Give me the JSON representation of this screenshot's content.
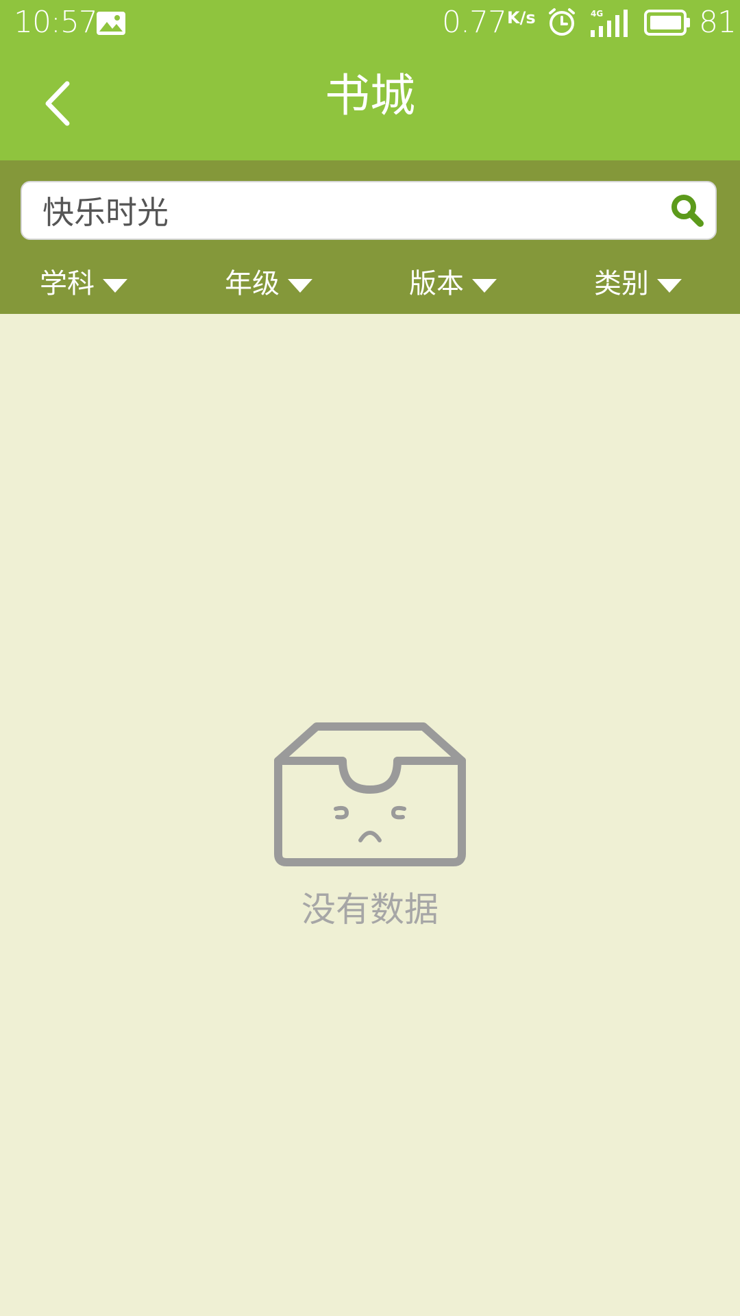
{
  "status_bar": {
    "time": "10:57",
    "network_speed": "0.77",
    "network_speed_unit": "K/s",
    "battery_level": "81"
  },
  "title_bar": {
    "title": "书城"
  },
  "search": {
    "value": "快乐时光"
  },
  "filters": [
    {
      "label": "学科"
    },
    {
      "label": "年级"
    },
    {
      "label": "版本"
    },
    {
      "label": "类别"
    }
  ],
  "empty_state": {
    "message": "没有数据"
  },
  "colors": {
    "header": "#8fc43e",
    "filter_bar": "#84983a",
    "background": "#eff0d4",
    "search_icon": "#5c9a1b",
    "empty_gray": "#a6a6a6"
  },
  "icons": {
    "back": "chevron-left-icon",
    "search": "search-icon",
    "empty": "empty-box-icon"
  }
}
